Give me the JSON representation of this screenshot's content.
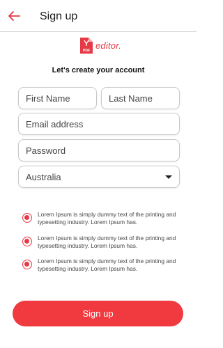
{
  "header": {
    "title": "Sign up"
  },
  "logo": {
    "text": "editor.",
    "badge": "PDF"
  },
  "subtitle": "Let's create your account",
  "form": {
    "first_name": {
      "placeholder": "First Name",
      "value": ""
    },
    "last_name": {
      "placeholder": "Last Name",
      "value": ""
    },
    "email": {
      "placeholder": "Email address",
      "value": ""
    },
    "password": {
      "placeholder": "Password",
      "value": ""
    },
    "country": {
      "selected": "Australia"
    }
  },
  "options": [
    {
      "text": "Lorem Ipsum is simply dummy text of the printing and typesetting industry. Lorem Ipsum has.",
      "checked": true
    },
    {
      "text": "Lorem Ipsum is simply dummy text of the printing and typesetting industry. Lorem Ipsum has.",
      "checked": true
    },
    {
      "text": "Lorem Ipsum is simply dummy text of the printing and typesetting industry. Lorem Ipsum has.",
      "checked": true
    }
  ],
  "signup_button": {
    "label": "Sign up"
  },
  "colors": {
    "accent": "#f03a40",
    "border": "#c8c8c8"
  },
  "icons": {
    "back": "arrow-left-icon",
    "dropdown": "caret-down-icon",
    "logo": "pdf-document-icon"
  }
}
